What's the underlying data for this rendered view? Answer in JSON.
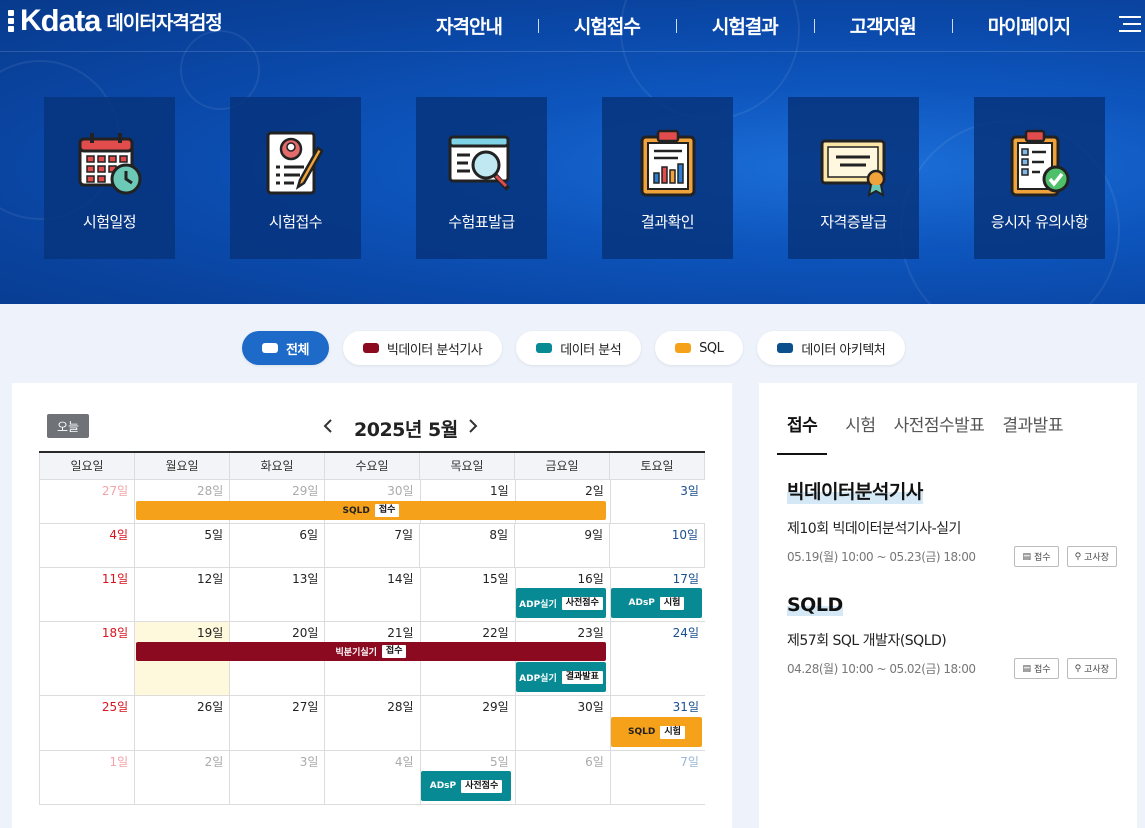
{
  "brand": {
    "logo_text": "data",
    "subtitle": "데이터자격검정"
  },
  "nav": [
    {
      "label": "자격안내"
    },
    {
      "label": "시험접수"
    },
    {
      "label": "시험결과"
    },
    {
      "label": "고객지원"
    },
    {
      "label": "마이페이지"
    }
  ],
  "quick_links": [
    {
      "label": "시험일정",
      "icon": "calendar-icon"
    },
    {
      "label": "시험접수",
      "icon": "application-form-icon"
    },
    {
      "label": "수험표발급",
      "icon": "search-document-icon"
    },
    {
      "label": "결과확인",
      "icon": "clipboard-chart-icon"
    },
    {
      "label": "자격증발급",
      "icon": "certificate-icon"
    },
    {
      "label": "응시자 유의사항",
      "icon": "checklist-icon"
    }
  ],
  "filters": [
    {
      "label": "전체",
      "active": true,
      "color": "#ffffff"
    },
    {
      "label": "빅데이터 분석기사",
      "color": "#8b0a1f"
    },
    {
      "label": "데이터 분석",
      "color": "#078a94"
    },
    {
      "label": "SQL",
      "color": "#f5a11a"
    },
    {
      "label": "데이터 아키텍처",
      "color": "#0b4f8c"
    }
  ],
  "calendar": {
    "today_label": "오늘",
    "month_title": "2025년 5월",
    "weekdays": [
      "일요일",
      "월요일",
      "화요일",
      "수요일",
      "목요일",
      "금요일",
      "토요일"
    ],
    "weeks": [
      [
        "27일",
        "28일",
        "29일",
        "30일",
        "1일",
        "2일",
        "3일"
      ],
      [
        "4일",
        "5일",
        "6일",
        "7일",
        "8일",
        "9일",
        "10일"
      ],
      [
        "11일",
        "12일",
        "13일",
        "14일",
        "15일",
        "16일",
        "17일"
      ],
      [
        "18일",
        "19일",
        "20일",
        "21일",
        "22일",
        "23일",
        "24일"
      ],
      [
        "25일",
        "26일",
        "27일",
        "28일",
        "29일",
        "30일",
        "31일"
      ],
      [
        "1일",
        "2일",
        "3일",
        "4일",
        "5일",
        "6일",
        "7일"
      ]
    ],
    "events": {
      "sqld_reg": {
        "name": "SQLD",
        "tag": "접수",
        "color": "#f5a11a"
      },
      "adp_pre": {
        "name": "ADP실기",
        "tag": "사전점수",
        "color": "#078a94"
      },
      "adsp_exam": {
        "name": "ADsP",
        "tag": "시험",
        "color": "#078a94"
      },
      "bigdata_reg": {
        "name": "빅분기실기",
        "tag": "접수",
        "color": "#8b0a1f"
      },
      "adp_result": {
        "name": "ADP실기",
        "tag": "결과발표",
        "color": "#078a94"
      },
      "sqld_exam": {
        "name": "SQLD",
        "tag": "시험",
        "color": "#f5a11a"
      },
      "adsp_pre": {
        "name": "ADsP",
        "tag": "사전점수",
        "color": "#078a94"
      }
    }
  },
  "side": {
    "tabs": [
      "접수",
      "시험",
      "사전점수발표",
      "결과발표"
    ],
    "exams": [
      {
        "title": "빅데이터분석기사",
        "name": "제10회 빅데이터분석기사-실기",
        "date": "05.19(월) 10:00 ~ 05.23(금) 18:00",
        "btn1": "접수",
        "btn2": "고사장"
      },
      {
        "title": "SQLD",
        "name": "제57회 SQL 개발자(SQLD)",
        "date": "04.28(월) 10:00 ~ 05.02(금) 18:00",
        "btn1": "접수",
        "btn2": "고사장"
      }
    ]
  }
}
